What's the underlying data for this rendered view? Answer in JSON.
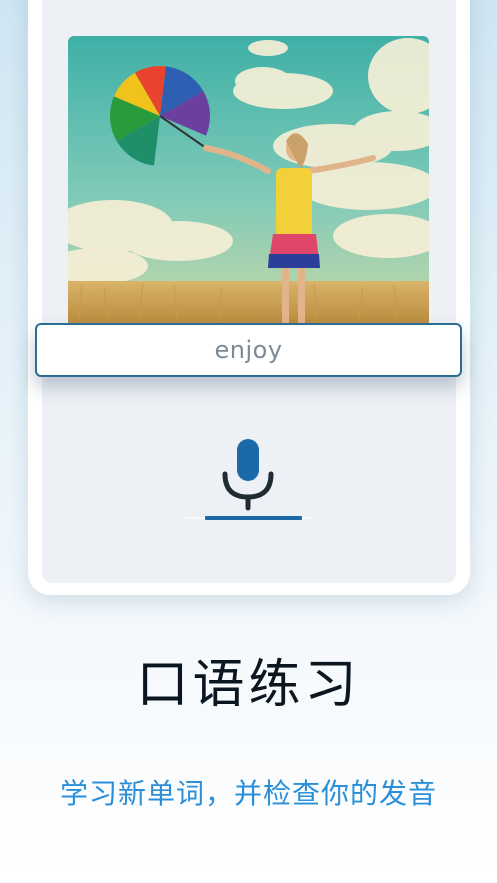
{
  "lesson_card": {
    "word": "enjoy"
  },
  "mic_icon": "microphone-icon",
  "recording_progress": 0.68,
  "feature": {
    "title": "口语练习",
    "subtitle": "学习新单词，并检查你的发音"
  },
  "colors": {
    "accent": "#1b69a8",
    "subtitle": "#2a8fd6",
    "title": "#0b1620",
    "card_border": "#2d6d93",
    "word_text": "#7c8a96"
  }
}
